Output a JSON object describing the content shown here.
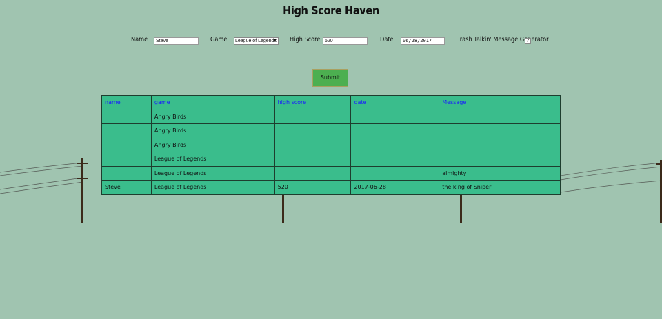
{
  "title": "High Score Haven",
  "form": {
    "name_label": "Name",
    "name_value": "Steve",
    "game_label": "Game",
    "game_selected": "League of Legends",
    "score_label": "High Score",
    "score_value": "520",
    "date_label": "Date",
    "date_value": "06/28/2017",
    "trash_label": "Trash Talkin' Message Generator",
    "trash_checked": true,
    "submit_label": "Submit"
  },
  "table": {
    "headers": [
      "name",
      "game",
      "high score",
      "date",
      "Message"
    ],
    "rows": [
      [
        "",
        "Angry Birds",
        "",
        "",
        ""
      ],
      [
        "",
        "Angry Birds",
        "",
        "",
        ""
      ],
      [
        "",
        "Angry Birds",
        "",
        "",
        ""
      ],
      [
        "",
        "League of Legends",
        "",
        "",
        ""
      ],
      [
        "",
        "League of Legends",
        "",
        "",
        "almighty"
      ],
      [
        "Steve",
        "League of Legends",
        "520",
        "2017-06-28",
        "the king of Sniper"
      ]
    ]
  },
  "colors": {
    "background": "#a0c4b0",
    "table": "#3abd8c",
    "header_link": "#1a1aff",
    "submit": "#4caf50",
    "pole": "#3b2a1a"
  },
  "icons": {
    "dropdown": "chevron-down-icon",
    "checkbox": "checkmark-icon"
  }
}
